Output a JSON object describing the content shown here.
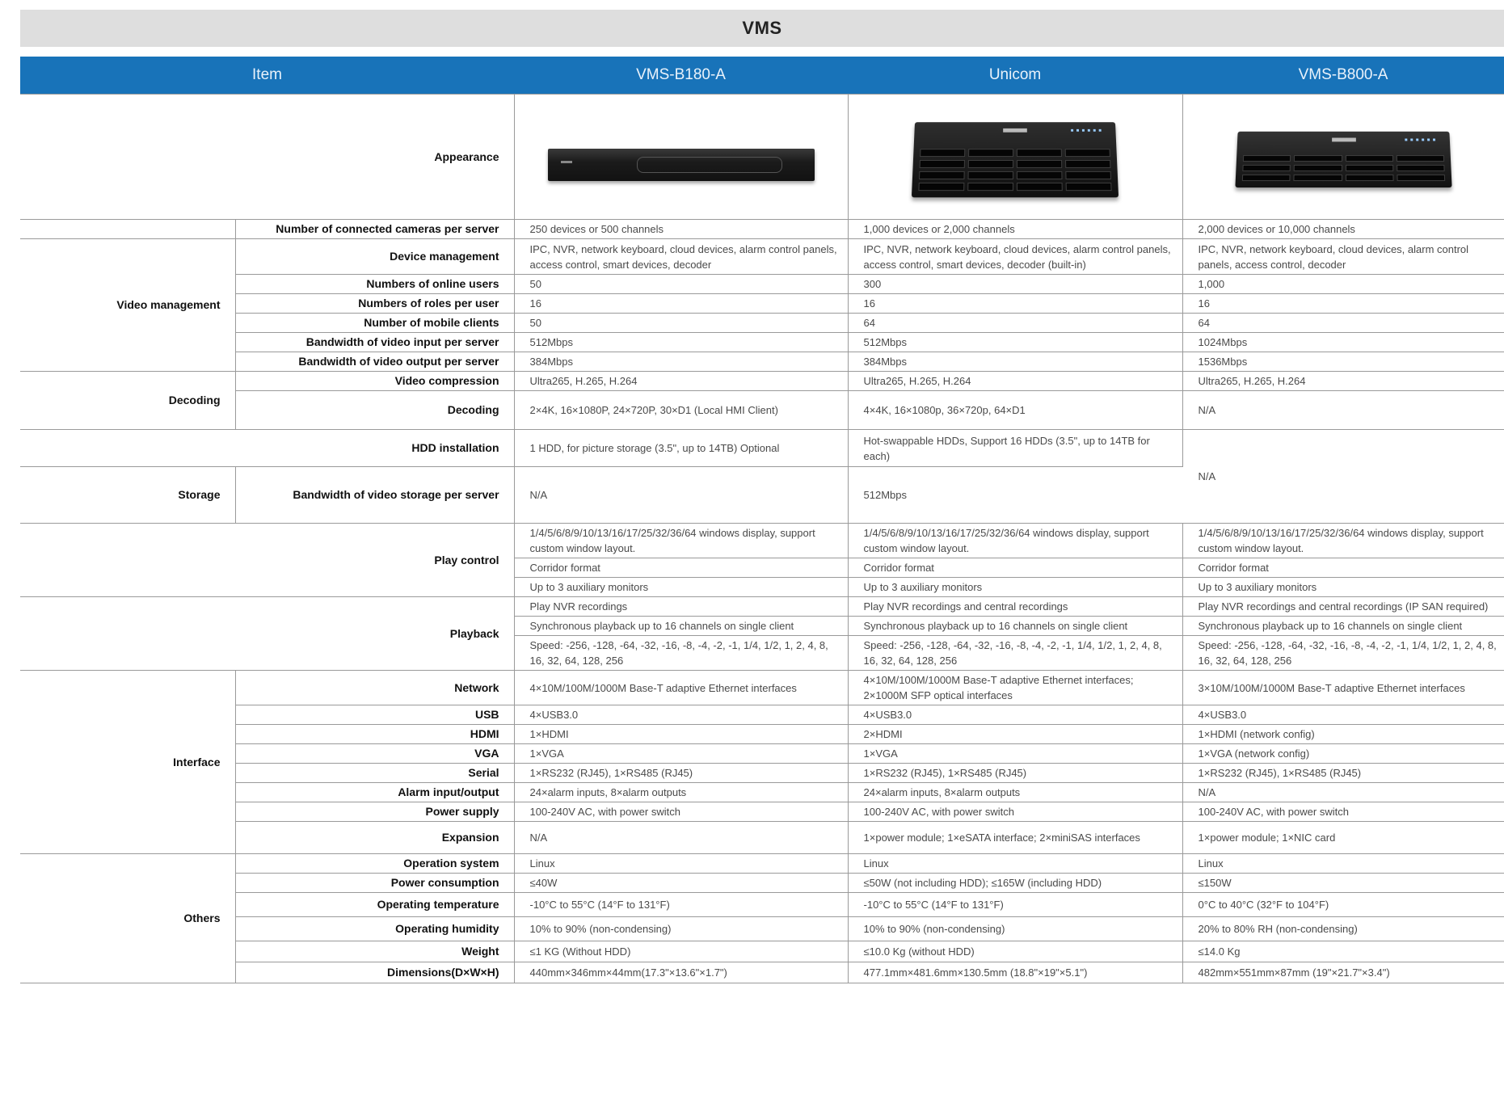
{
  "title": "VMS",
  "header": {
    "item": "Item",
    "models": [
      "VMS-B180-A",
      "Unicom",
      "VMS-B800-A"
    ]
  },
  "appearance_label": "Appearance",
  "device_images": [
    "rack-server-1u-icon",
    "rack-server-3u-icon",
    "rack-server-2u-icon"
  ],
  "categories": {
    "video": "Video management",
    "decoding": "Decoding",
    "storage": "Storage",
    "interface": "Interface",
    "others": "Others"
  },
  "rows": {
    "cameras": {
      "label": "Number of connected cameras per server",
      "v": [
        "250 devices or 500 channels",
        "1,000 devices or 2,000 channels",
        "2,000 devices or 10,000 channels"
      ]
    },
    "device_mgmt": {
      "label": "Device management",
      "v": [
        "IPC, NVR, network keyboard, cloud devices, alarm control panels, access control, smart devices, decoder",
        "IPC, NVR, network keyboard, cloud devices, alarm control panels, access control, smart devices, decoder (built-in)",
        "IPC, NVR, network keyboard, cloud devices, alarm control panels, access control, decoder"
      ]
    },
    "online_users": {
      "label": "Numbers of online users",
      "v": [
        "50",
        "300",
        "1,000"
      ]
    },
    "roles": {
      "label": "Numbers of roles per user",
      "v": [
        "16",
        "16",
        "16"
      ]
    },
    "mobile": {
      "label": "Number of mobile clients",
      "v": [
        "50",
        "64",
        "64"
      ]
    },
    "bw_in": {
      "label": "Bandwidth of video input per server",
      "v": [
        "512Mbps",
        "512Mbps",
        "1024Mbps"
      ]
    },
    "bw_out": {
      "label": "Bandwidth of video output per server",
      "v": [
        "384Mbps",
        "384Mbps",
        "1536Mbps"
      ]
    },
    "compression": {
      "label": "Video compression",
      "v": [
        "Ultra265, H.265, H.264",
        "Ultra265, H.265, H.264",
        "Ultra265, H.265, H.264"
      ]
    },
    "decoding": {
      "label": "Decoding",
      "v": [
        "2×4K, 16×1080P, 24×720P, 30×D1 (Local HMI Client)",
        "4×4K, 16×1080p, 36×720p, 64×D1",
        "N/A"
      ]
    },
    "hdd": {
      "label": "HDD installation",
      "v": [
        "1 HDD, for picture storage (3.5\", up to 14TB) Optional",
        "Hot-swappable HDDs, Support 16 HDDs (3.5\", up to 14TB for each)",
        "N/A"
      ]
    },
    "bw_storage": {
      "label": "Bandwidth of video storage per server",
      "v": [
        "N/A",
        "512Mbps"
      ]
    },
    "play_control": {
      "label": "Play control",
      "v": [
        [
          "1/4/5/6/8/9/10/13/16/17/25/32/36/64 windows display, support custom window layout.",
          "Corridor format",
          "Up to 3 auxiliary monitors"
        ],
        [
          "1/4/5/6/8/9/10/13/16/17/25/32/36/64 windows display, support custom window layout.",
          "Corridor format",
          "Up to 3 auxiliary monitors"
        ],
        [
          "1/4/5/6/8/9/10/13/16/17/25/32/36/64 windows display, support custom window layout.",
          "Corridor format",
          "Up to 3 auxiliary monitors"
        ]
      ]
    },
    "playback": {
      "label": "Playback",
      "v": [
        [
          "Play NVR recordings",
          "Synchronous playback up to 16 channels on single client",
          "Speed: -256, -128, -64, -32, -16, -8, -4, -2, -1, 1/4, 1/2, 1, 2, 4, 8, 16, 32, 64, 128, 256"
        ],
        [
          "Play NVR recordings and central recordings",
          "Synchronous playback up to 16 channels on single client",
          "Speed: -256, -128, -64, -32, -16, -8, -4, -2, -1, 1/4, 1/2, 1, 2, 4, 8, 16, 32, 64, 128, 256"
        ],
        [
          "Play NVR recordings and central recordings (IP SAN required)",
          "Synchronous playback up to 16 channels on single client",
          "Speed: -256, -128, -64, -32, -16, -8, -4, -2, -1, 1/4, 1/2, 1, 2, 4, 8, 16, 32, 64, 128, 256"
        ]
      ]
    },
    "network": {
      "label": "Network",
      "v": [
        "4×10M/100M/1000M Base-T adaptive Ethernet interfaces",
        "4×10M/100M/1000M Base-T adaptive Ethernet interfaces; 2×1000M SFP optical interfaces",
        "3×10M/100M/1000M Base-T adaptive Ethernet interfaces"
      ]
    },
    "usb": {
      "label": "USB",
      "v": [
        "4×USB3.0",
        "4×USB3.0",
        "4×USB3.0"
      ]
    },
    "hdmi": {
      "label": "HDMI",
      "v": [
        "1×HDMI",
        "2×HDMI",
        "1×HDMI (network config)"
      ]
    },
    "vga": {
      "label": "VGA",
      "v": [
        "1×VGA",
        "1×VGA",
        "1×VGA (network config)"
      ]
    },
    "serial": {
      "label": "Serial",
      "v": [
        "1×RS232 (RJ45), 1×RS485 (RJ45)",
        "1×RS232 (RJ45), 1×RS485 (RJ45)",
        "1×RS232 (RJ45), 1×RS485 (RJ45)"
      ]
    },
    "alarm": {
      "label": "Alarm input/output",
      "v": [
        "24×alarm inputs, 8×alarm outputs",
        "24×alarm inputs, 8×alarm outputs",
        "N/A"
      ]
    },
    "power_supply": {
      "label": "Power supply",
      "v": [
        "100-240V AC, with power switch",
        "100-240V AC, with power switch",
        "100-240V AC, with power switch"
      ]
    },
    "expansion": {
      "label": "Expansion",
      "v": [
        "N/A",
        "1×power module; 1×eSATA interface; 2×miniSAS interfaces",
        "1×power module; 1×NIC card"
      ]
    },
    "os": {
      "label": "Operation system",
      "v": [
        "Linux",
        "Linux",
        "Linux"
      ]
    },
    "power_cons": {
      "label": "Power consumption",
      "v": [
        "≤40W",
        "≤50W (not including HDD); ≤165W (including HDD)",
        "≤150W"
      ]
    },
    "op_temp": {
      "label": "Operating temperature",
      "v": [
        "-10°C to 55°C (14°F to 131°F)",
        "-10°C to 55°C (14°F to 131°F)",
        "0°C to 40°C (32°F to 104°F)"
      ]
    },
    "op_humidity": {
      "label": "Operating humidity",
      "v": [
        "10% to 90% (non-condensing)",
        "10% to 90% (non-condensing)",
        "20% to 80% RH (non-condensing)"
      ]
    },
    "weight": {
      "label": "Weight",
      "v": [
        "≤1 KG (Without HDD)",
        "≤10.0 Kg (without HDD)",
        "≤14.0 Kg"
      ]
    },
    "dimensions": {
      "label": "Dimensions(D×W×H)",
      "v": [
        "440mm×346mm×44mm(17.3\"×13.6\"×1.7\")",
        "477.1mm×481.6mm×130.5mm (18.8\"×19\"×5.1\")",
        "482mm×551mm×87mm (19\"×21.7\"×3.4\")"
      ]
    }
  },
  "colors": {
    "header_blue": "#1873b9",
    "title_bar": "#dedede",
    "border": "#9a9a9a"
  }
}
